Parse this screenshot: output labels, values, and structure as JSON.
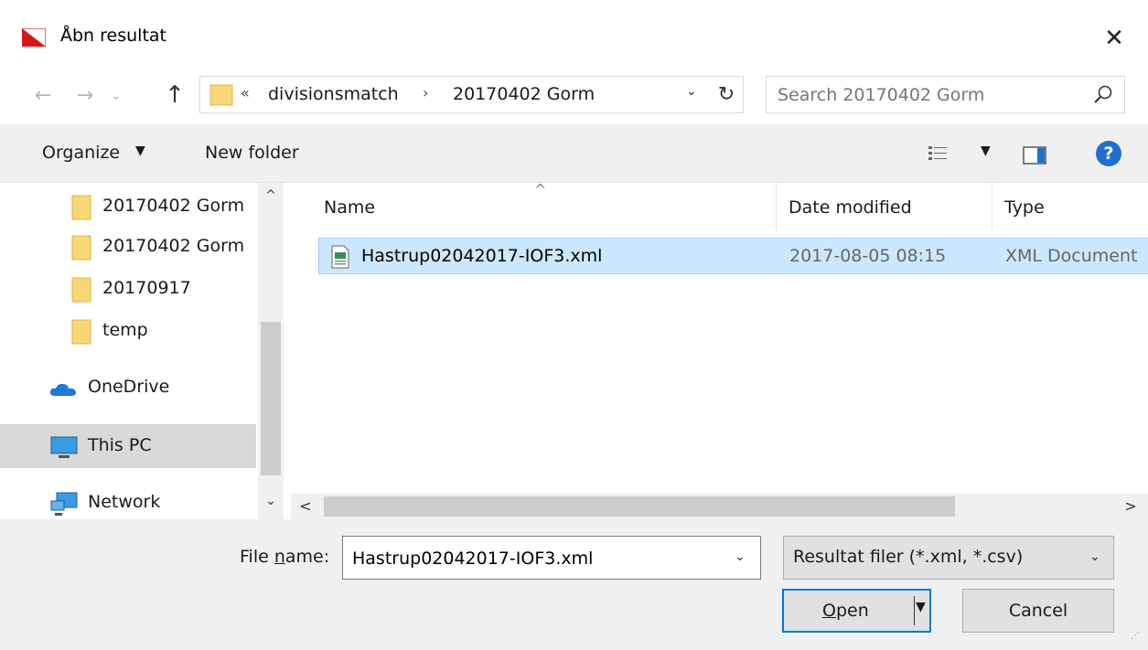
{
  "window": {
    "title": "Åbn resultat"
  },
  "nav": {
    "back": "←",
    "forward": "→",
    "recent": "⌄",
    "up": "↑"
  },
  "address": {
    "overflow": "«",
    "crumbs": [
      "divisionsmatch",
      "20170402 Gorm"
    ],
    "separator": "›",
    "dropdown": "⌄",
    "refresh": "↻"
  },
  "search": {
    "placeholder": "Search 20170402 Gorm"
  },
  "toolbar": {
    "organize": "Organize",
    "organize_caret": "▼",
    "new_folder": "New folder",
    "view_caret": "▼",
    "help": "?"
  },
  "tree": {
    "items": [
      {
        "label": "20170402 Gorm",
        "icon": "folder-icon"
      },
      {
        "label": "20170402 Gorm",
        "icon": "folder-icon"
      },
      {
        "label": "20170917",
        "icon": "folder-icon"
      },
      {
        "label": "temp",
        "icon": "folder-icon"
      },
      {
        "label": "OneDrive",
        "icon": "onedrive-icon"
      },
      {
        "label": "This PC",
        "icon": "this-pc-icon",
        "selected": true
      },
      {
        "label": "Network",
        "icon": "network-icon"
      }
    ],
    "scroll_up": "^",
    "scroll_down": "⌄"
  },
  "files": {
    "sort_indicator": "^",
    "columns": [
      "Name",
      "Date modified",
      "Type"
    ],
    "rows": [
      {
        "name": "Hastrup02042017-IOF3.xml",
        "date": "2017-08-05 08:15",
        "type": "XML Document",
        "selected": true
      }
    ],
    "hscroll_left": "<",
    "hscroll_right": ">"
  },
  "bottom": {
    "filename_label_prefix": "File ",
    "filename_label_accel": "n",
    "filename_label_suffix": "ame:",
    "filename_value": "Hastrup02042017-IOF3.xml",
    "filetype_value": "Resultat filer (*.xml, *.csv)",
    "dropdown": "⌄",
    "open_accel": "O",
    "open_rest": "pen",
    "open_caret": "▼",
    "cancel": "Cancel"
  },
  "colors": {
    "selection_bg": "#cce8ff",
    "selection_border": "#99d1ff",
    "accent": "#0078d7",
    "help": "#1f6fd1",
    "folder": "#f8d775"
  }
}
